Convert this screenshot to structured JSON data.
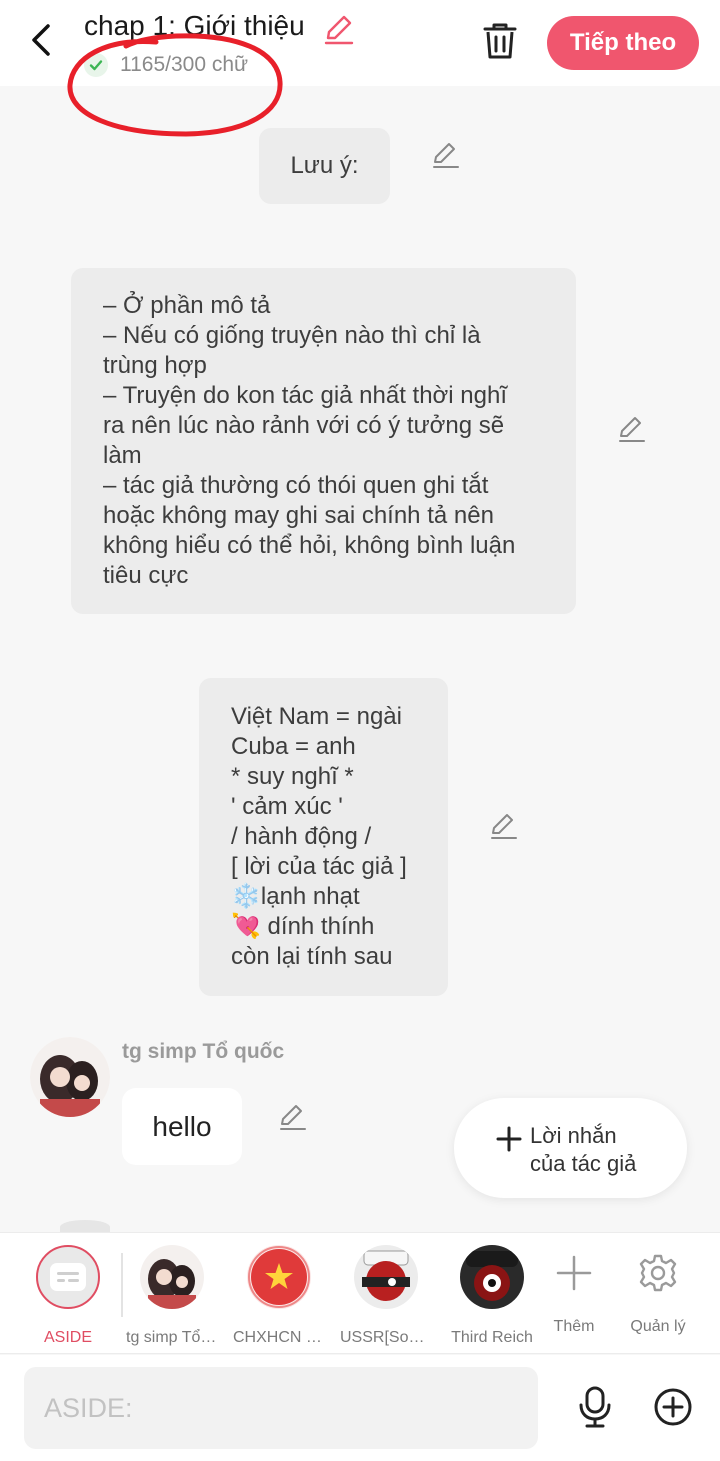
{
  "header": {
    "title": "chap 1: Giới thiệu",
    "word_count": "1165/300 chữ",
    "next_label": "Tiếp theo"
  },
  "notes": {
    "note1": "Lưu ý:",
    "note2_lines": [
      "– Ở phần mô tả",
      "– Nếu có giống truyện nào thì chỉ là",
      "trùng hợp",
      "– Truyện do kon tác giả nhất thời nghĩ",
      "ra nên lúc nào rảnh với có ý tưởng sẽ",
      "làm",
      "– tác giả thường có thói quen ghi tắt",
      "hoặc không may ghi sai chính tả nên",
      "không hiểu có thể hỏi, không bình luận",
      "tiêu cực"
    ],
    "note3_lines": [
      "Việt Nam = ngài",
      "Cuba = anh",
      "* suy nghĩ *",
      "' cảm xúc '",
      "/ hành động /",
      "[ lời của tác giả ]",
      "❄️lạnh nhạt",
      "💘 dính thính",
      "còn lại tính sau"
    ]
  },
  "message": {
    "author": "tg simp Tổ quốc",
    "text": "hello"
  },
  "fab": {
    "line1": "Lời nhắn",
    "line2": "của tác giả"
  },
  "characters": [
    {
      "label": "ASIDE",
      "icon": "aside-icon"
    },
    {
      "label": "tg simp Tổ quốc"
    },
    {
      "label": "CHXHCN Việt Nam"
    },
    {
      "label": "USSR[Soviet]"
    },
    {
      "label": "Third Reich"
    }
  ],
  "tools": {
    "add_label": "Thêm",
    "manage_label": "Quản lý"
  },
  "input": {
    "placeholder": "ASIDE:"
  },
  "colors": {
    "accent": "#f0566e",
    "annotation": "#e8202a"
  }
}
